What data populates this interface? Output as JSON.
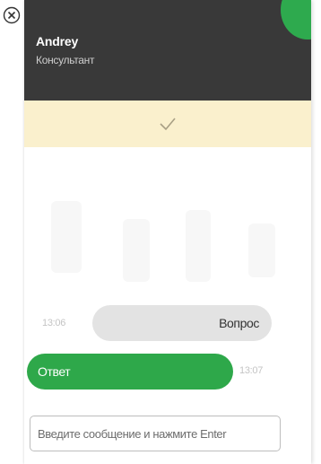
{
  "header": {
    "agent_name": "Andrey",
    "agent_role": "Консультант"
  },
  "icons": {
    "close": "close-icon",
    "check": "check-icon"
  },
  "messages": [
    {
      "direction": "incoming",
      "text": "Вопрос",
      "time": "13:06"
    },
    {
      "direction": "outgoing",
      "text": "Ответ",
      "time": "13:07"
    }
  ],
  "input": {
    "placeholder": "Введите сообщение и нажмите Enter",
    "value": ""
  },
  "colors": {
    "header_bg": "#393939",
    "accent_green": "#2ea84a",
    "banner_bg": "#faf0cd",
    "incoming_bubble": "#e3e3e3"
  }
}
